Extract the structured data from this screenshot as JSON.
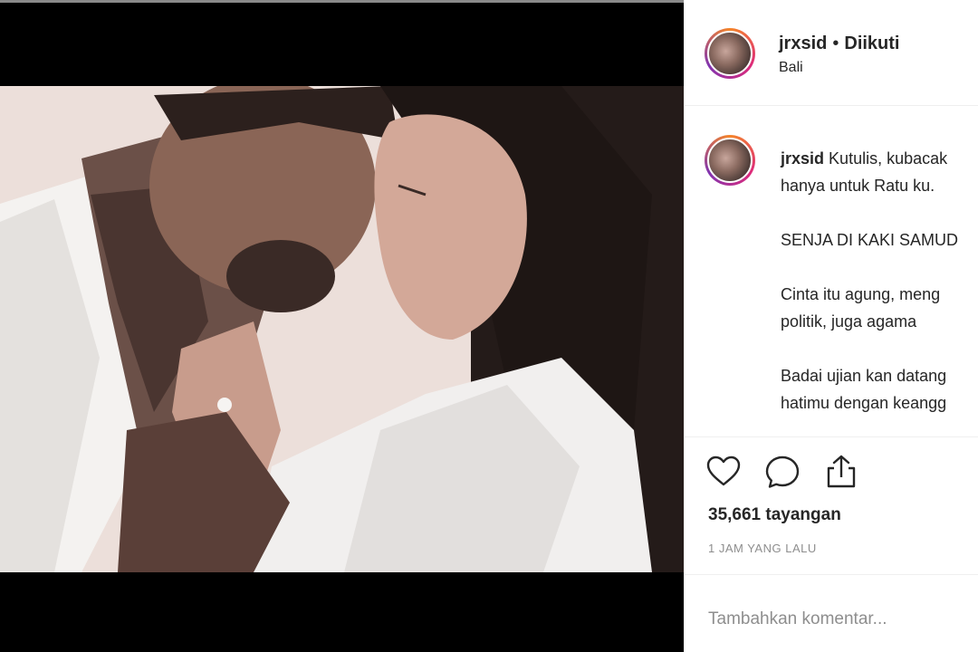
{
  "post": {
    "username": "jrxsid",
    "separator": "•",
    "follow_status": "Diikuti",
    "location": "Bali"
  },
  "caption": {
    "username": "jrxsid",
    "lines": [
      "Kutulis, kubacak",
      "hanya untuk Ratu ku.",
      "",
      "SENJA DI KAKI SAMUD",
      "",
      "Cinta itu agung, meng",
      "politik, juga agama",
      "",
      "Badai ujian kan datang",
      "hatimu dengan keangg"
    ]
  },
  "actions": {
    "like_icon": "heart-icon",
    "comment_icon": "comment-icon",
    "share_icon": "share-icon"
  },
  "stats": {
    "views": "35,661 tayangan",
    "time_ago": "1 JAM YANG LALU"
  },
  "comment": {
    "placeholder": "Tambahkan komentar..."
  },
  "colors": {
    "text": "#262626",
    "secondary": "#8e8e8e",
    "divider": "#efefef",
    "media_bg": "#000000"
  }
}
